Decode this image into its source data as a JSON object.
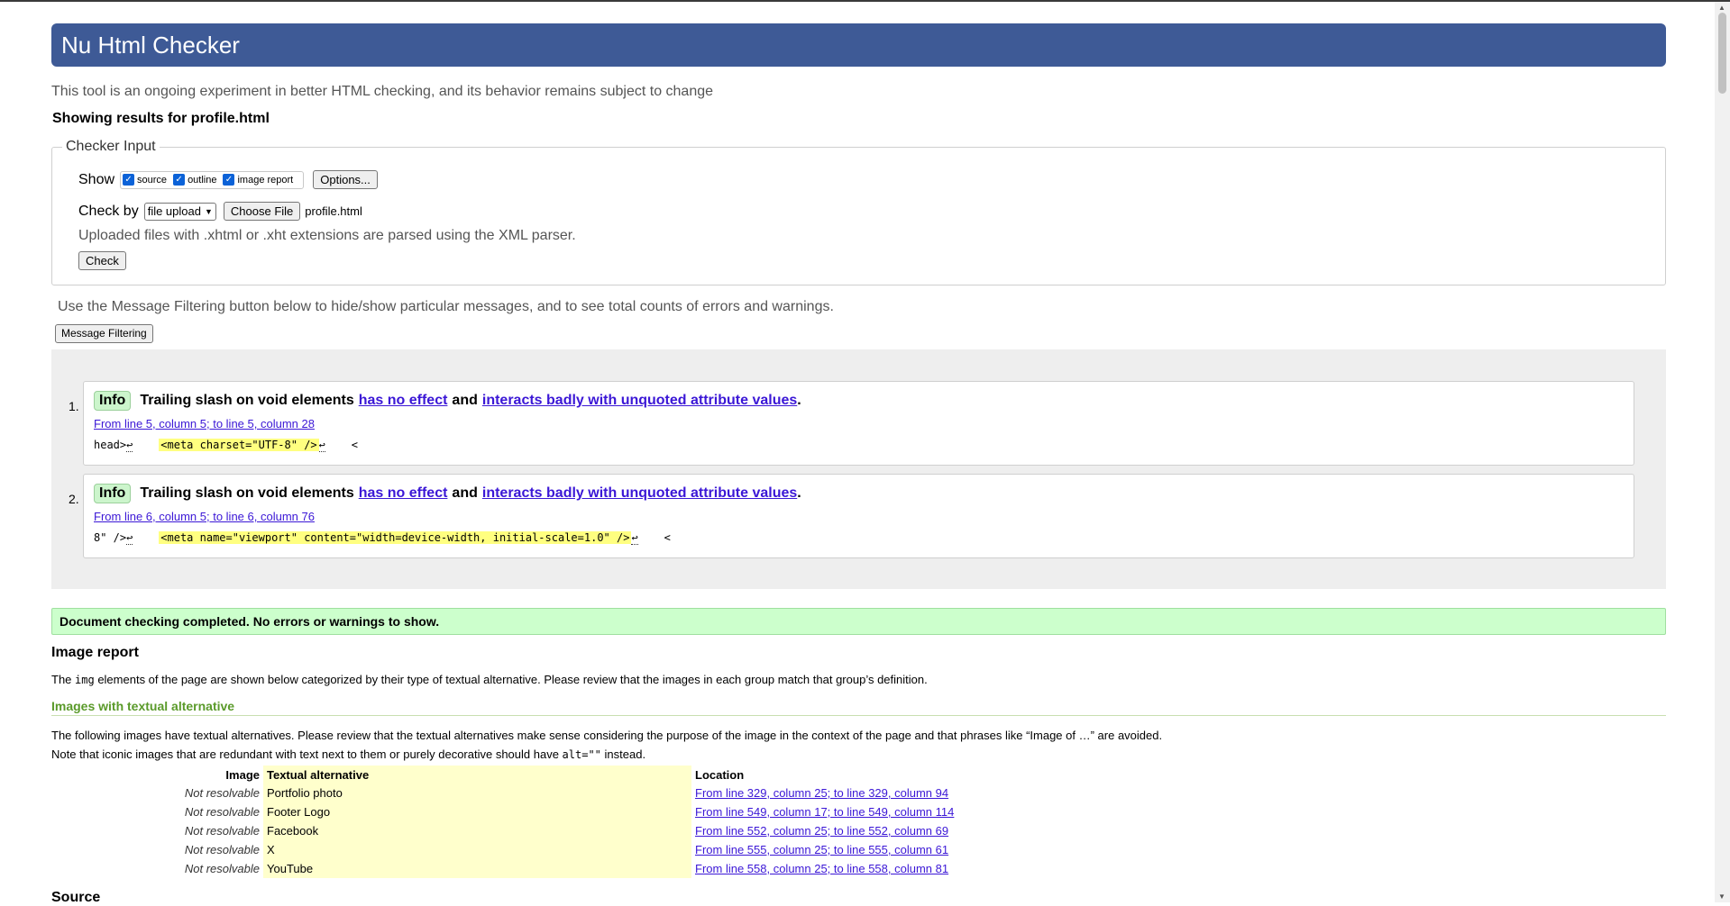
{
  "header": {
    "title": "Nu Html Checker",
    "subtitle": "This tool is an ongoing experiment in better HTML checking, and its behavior remains subject to change",
    "showing": "Showing results for profile.html"
  },
  "checker_input": {
    "legend": "Checker Input",
    "show_label": "Show",
    "show_options": [
      "source",
      "outline",
      "image report"
    ],
    "options_button": "Options...",
    "check_by_label": "Check by",
    "check_by_value": "file upload",
    "choose_file_button": "Choose File",
    "file_name": "profile.html",
    "xml_note": "Uploaded files with .xhtml or .xht extensions are parsed using the XML parser.",
    "check_button": "Check"
  },
  "filter": {
    "note": "Use the Message Filtering button below to hide/show particular messages, and to see total counts of errors and warnings.",
    "button": "Message Filtering"
  },
  "messages": [
    {
      "number": "1.",
      "type": "Info",
      "text_a": "Trailing slash on void elements",
      "link1": "has no effect",
      "text_b": "and",
      "link2": "interacts badly with unquoted attribute values",
      "text_c": ".",
      "location": "From line 5, column 5; to line 5, column 28",
      "code_before": "head>",
      "code_highlight": "<meta charset=\"UTF-8\" />",
      "code_after": "<"
    },
    {
      "number": "2.",
      "type": "Info",
      "text_a": "Trailing slash on void elements",
      "link1": "has no effect",
      "text_b": "and",
      "link2": "interacts badly with unquoted attribute values",
      "text_c": ".",
      "location": "From line 6, column 5; to line 6, column 76",
      "code_before": "8\" />",
      "code_highlight": "<meta name=\"viewport\" content=\"width=device-width, initial-scale=1.0\" />",
      "code_after": "<"
    }
  ],
  "done": "Document checking completed. No errors or warnings to show.",
  "image_report": {
    "title": "Image report",
    "desc_a": "The ",
    "desc_code": "img",
    "desc_b": " elements of the page are shown below categorized by their type of textual alternative. Please review that the images in each group match that group’s definition.",
    "section_title": "Images with textual alternative",
    "alt_desc1": "The following images have textual alternatives. Please review that the textual alternatives make sense considering the purpose of the image in the context of the page and that phrases like “Image of …” are avoided.",
    "alt_desc2_a": "Note that iconic images that are redundant with text next to them or purely decorative should have ",
    "alt_desc2_code": "alt=\"\"",
    "alt_desc2_b": " instead.",
    "table_headers": [
      "Image",
      "Textual alternative",
      "Location"
    ],
    "rows": [
      {
        "image": "Not resolvable",
        "alt": "Portfolio photo",
        "location": "From line 329, column 25; to line 329, column 94"
      },
      {
        "image": "Not resolvable",
        "alt": "Footer Logo",
        "location": "From line 549, column 17; to line 549, column 114"
      },
      {
        "image": "Not resolvable",
        "alt": "Facebook",
        "location": "From line 552, column 25; to line 552, column 69"
      },
      {
        "image": "Not resolvable",
        "alt": "X",
        "location": "From line 555, column 25; to line 555, column 61"
      },
      {
        "image": "Not resolvable",
        "alt": "YouTube",
        "location": "From line 558, column 25; to line 558, column 81"
      }
    ]
  },
  "source_title": "Source"
}
